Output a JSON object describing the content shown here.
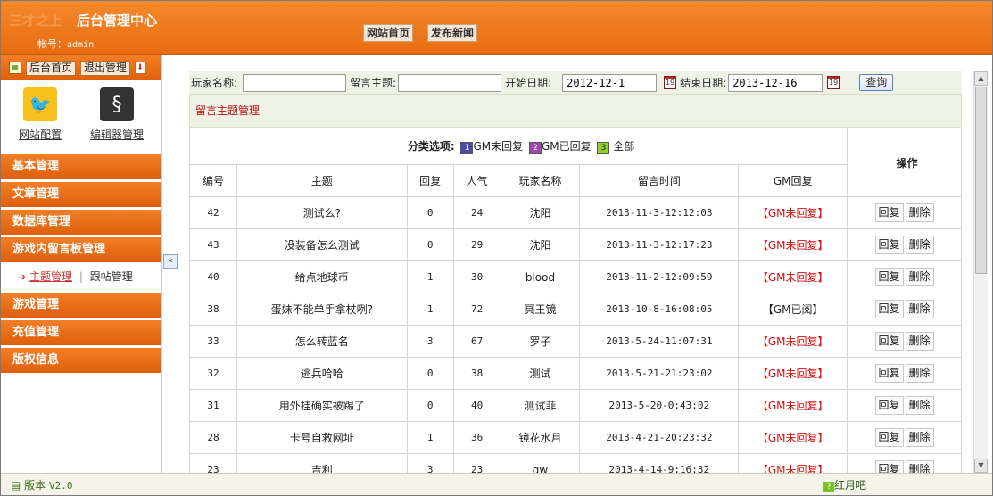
{
  "header": {
    "ghost_logo": "三才之上",
    "title": "后台管理中心",
    "account_label": "帐号：",
    "account_value": "admin",
    "nav": [
      "网站首页",
      "发布新闻"
    ]
  },
  "sidebar": {
    "toolbar": {
      "home": "后台首页",
      "logout": "退出管理"
    },
    "quick": [
      {
        "label": "网站配置",
        "icon": "bird-icon"
      },
      {
        "label": "编辑器管理",
        "icon": "editor-icon"
      }
    ],
    "menu": [
      "基本管理",
      "文章管理",
      "数据库管理",
      "游戏内留言板管理"
    ],
    "submenu": {
      "active": "主题管理",
      "other": "跟帖管理"
    },
    "menu2": [
      "游戏管理",
      "充值管理",
      "版权信息"
    ]
  },
  "filter": {
    "player_label": "玩家名称:",
    "player_value": "",
    "topic_label": "留言主题:",
    "topic_value": "",
    "start_label": "开始日期:",
    "start_value": "2012-12-1",
    "end_label": "结束日期:",
    "end_value": "2013-12-16",
    "query": "查询"
  },
  "section_title": "留言主题管理",
  "categories": {
    "label": "分类选项:",
    "items": [
      {
        "chip": "1",
        "text": "GM未回复"
      },
      {
        "chip": "2",
        "text": "GM已回复"
      },
      {
        "chip": "3",
        "text": "全部"
      }
    ],
    "ops": "操作"
  },
  "columns": [
    "编号",
    "主题",
    "回复",
    "人气",
    "玩家名称",
    "留言时间",
    "GM回复"
  ],
  "rows": [
    {
      "id": "42",
      "topic": "测试么?",
      "replies": "0",
      "views": "24",
      "player": "沈阳",
      "time": "2013-11-3-12:12:03",
      "gm": "【GM未回复】",
      "red": true
    },
    {
      "id": "43",
      "topic": "没装备怎么测试",
      "replies": "0",
      "views": "29",
      "player": "沈阳",
      "time": "2013-11-3-12:17:23",
      "gm": "【GM未回复】",
      "red": true
    },
    {
      "id": "40",
      "topic": "给点地球币",
      "replies": "1",
      "views": "30",
      "player": "blood",
      "time": "2013-11-2-12:09:59",
      "gm": "【GM未回复】",
      "red": true
    },
    {
      "id": "38",
      "topic": "蛋妹不能单手拿杖咧?",
      "replies": "1",
      "views": "72",
      "player": "冥王镜",
      "time": "2013-10-8-16:08:05",
      "gm": "【GM已阅】",
      "red": false
    },
    {
      "id": "33",
      "topic": "怎么转蓝名",
      "replies": "3",
      "views": "67",
      "player": "罗子",
      "time": "2013-5-24-11:07:31",
      "gm": "【GM未回复】",
      "red": true
    },
    {
      "id": "32",
      "topic": "逃兵哈哈",
      "replies": "0",
      "views": "38",
      "player": "测试",
      "time": "2013-5-21-21:23:02",
      "gm": "【GM未回复】",
      "red": true
    },
    {
      "id": "31",
      "topic": "用外挂确实被踢了",
      "replies": "0",
      "views": "40",
      "player": "测试菲",
      "time": "2013-5-20-0:43:02",
      "gm": "【GM未回复】",
      "red": true
    },
    {
      "id": "28",
      "topic": "卡号自救网址",
      "replies": "1",
      "views": "36",
      "player": "镜花水月",
      "time": "2013-4-21-20:23:32",
      "gm": "【GM未回复】",
      "red": true
    },
    {
      "id": "23",
      "topic": "吉利",
      "replies": "3",
      "views": "23",
      "player": "gw",
      "time": "2013-4-14-9:16:32",
      "gm": "【GM未回复】",
      "red": true
    }
  ],
  "actions": {
    "reply": "回复",
    "delete": "删除"
  },
  "footer": {
    "version_label": "版本",
    "version": "V2.0",
    "brand": "红月吧"
  },
  "colors": {
    "header_orange": "#e86b0e",
    "menu_orange": "#de5f0c",
    "gm_unreplied": "#d41010",
    "panel_green": "#eef3e6"
  }
}
